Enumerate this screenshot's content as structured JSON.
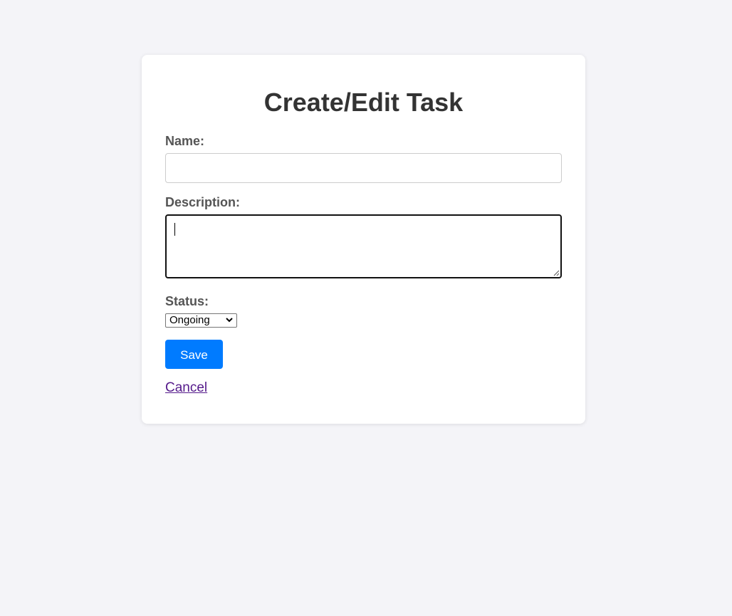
{
  "form": {
    "title": "Create/Edit Task",
    "name_label": "Name:",
    "name_value": "",
    "description_label": "Description:",
    "description_value": "",
    "status_label": "Status:",
    "status_value": "Ongoing",
    "save_label": "Save",
    "cancel_label": "Cancel"
  },
  "icons": {
    "status_dropdown": "chevron-down-icon",
    "textarea_resize": "resize-grip-icon"
  },
  "colors": {
    "page_background": "#f4f4f8",
    "card_background": "#ffffff",
    "primary_button": "#007bff",
    "visited_link": "#551a8b"
  }
}
